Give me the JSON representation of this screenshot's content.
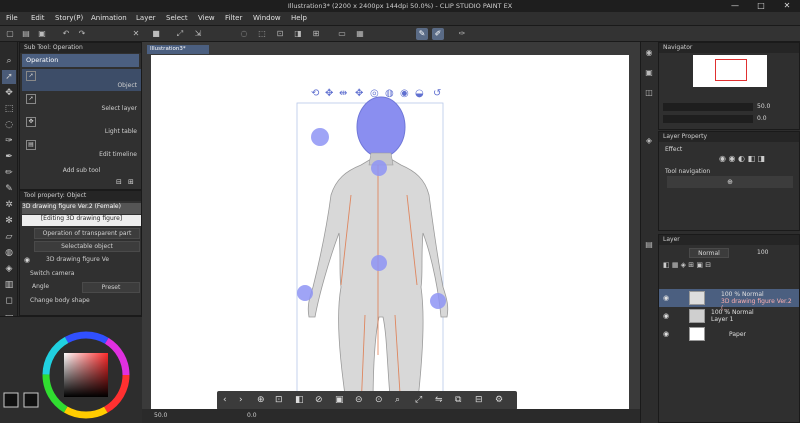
{
  "window": {
    "title": "Illustration3* (2200 x 2400px 144dpi 50.0%)  - CLIP STUDIO PAINT EX",
    "minimize": "—",
    "maximize": "□",
    "close": "✕"
  },
  "menu": [
    "File",
    "Edit",
    "Story(P)",
    "Animation",
    "Layer",
    "Select",
    "View",
    "Filter",
    "Window",
    "Help"
  ],
  "subtool": {
    "header": "Sub Tool: Operation",
    "group": "Operation",
    "items": [
      "Object",
      "Select layer",
      "Light table",
      "Edit timeline"
    ],
    "add_label": "Add sub tool"
  },
  "toolprop": {
    "header": "Tool property: Object",
    "name_field": "3D drawing figure Ver.2 (Female)",
    "editing_label": "[Editing 3D drawing figure]",
    "dropdown1": "Operation of transparent part",
    "dropdown2": "Selectable object",
    "object_label": "3D drawing figure Ve",
    "switch_camera": "Switch camera",
    "angle_label": "Angle",
    "preset": "Preset",
    "change_body": "Change body shape"
  },
  "canvas": {
    "tab": "Illustration3*",
    "zoom": "50.0",
    "status_value": "0.0"
  },
  "navigator": {
    "header": "Navigator",
    "zoom": "50.0",
    "angle": "0.0"
  },
  "layerprop": {
    "header": "Layer Property",
    "effect": "Effect",
    "tool_nav": "Tool navigation"
  },
  "layers": {
    "header": "Layer",
    "blend": "Normal",
    "opacity": "100",
    "rows": [
      {
        "percent": "100 % Normal",
        "name": "3D drawing figure Ver.2 (..."
      },
      {
        "percent": "100 % Normal",
        "name": "Layer 1"
      },
      {
        "percent": "",
        "name": "Paper"
      }
    ]
  },
  "colors": {
    "accent": "#4b5f80",
    "figure_head": "#8a8ef0",
    "joint": "#8f95f5",
    "bone": "#e0784a",
    "panel": "#2f2f2f"
  },
  "icons": {
    "toolbar": [
      "new-icon",
      "open-icon",
      "save-icon",
      "undo-icon",
      "redo-icon",
      "brush-icon",
      "pen-icon"
    ]
  }
}
